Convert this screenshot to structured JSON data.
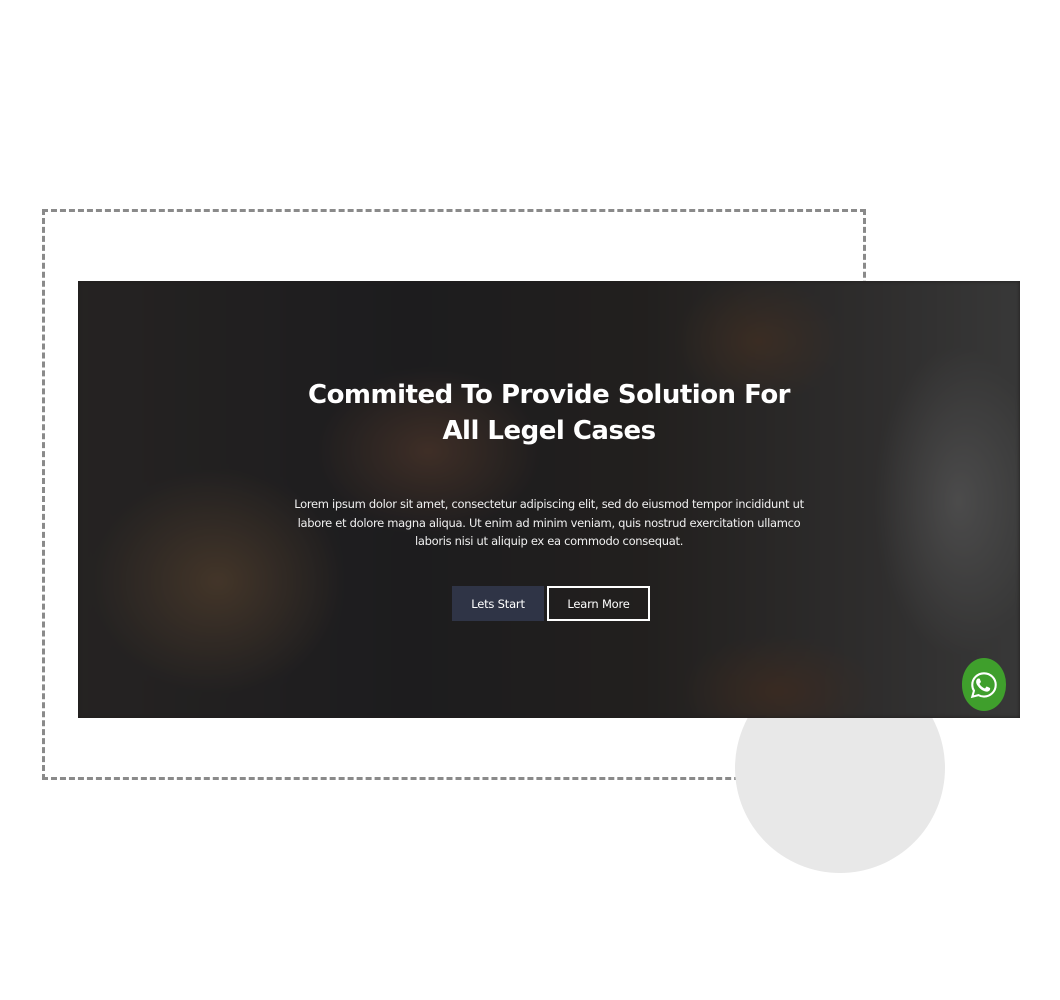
{
  "hero": {
    "title": "Commited To Provide Solution For All Legel Cases",
    "description": "Lorem ipsum dolor sit amet, consectetur adipiscing elit, sed do eiusmod tempor incididunt ut labore et dolore magna aliqua. Ut enim ad minim veniam, quis nostrud exercitation ullamco laboris nisi ut aliquip ex ea commodo consequat.",
    "primary_button_label": "Lets Start",
    "secondary_button_label": "Learn More"
  },
  "floating": {
    "whatsapp_icon": "whatsapp-icon"
  },
  "colors": {
    "primary_button": "#2f3446",
    "whatsapp_green": "#3f9f2c",
    "dashed_frame": "#8a8a8a",
    "circle": "#e8e8e8"
  }
}
